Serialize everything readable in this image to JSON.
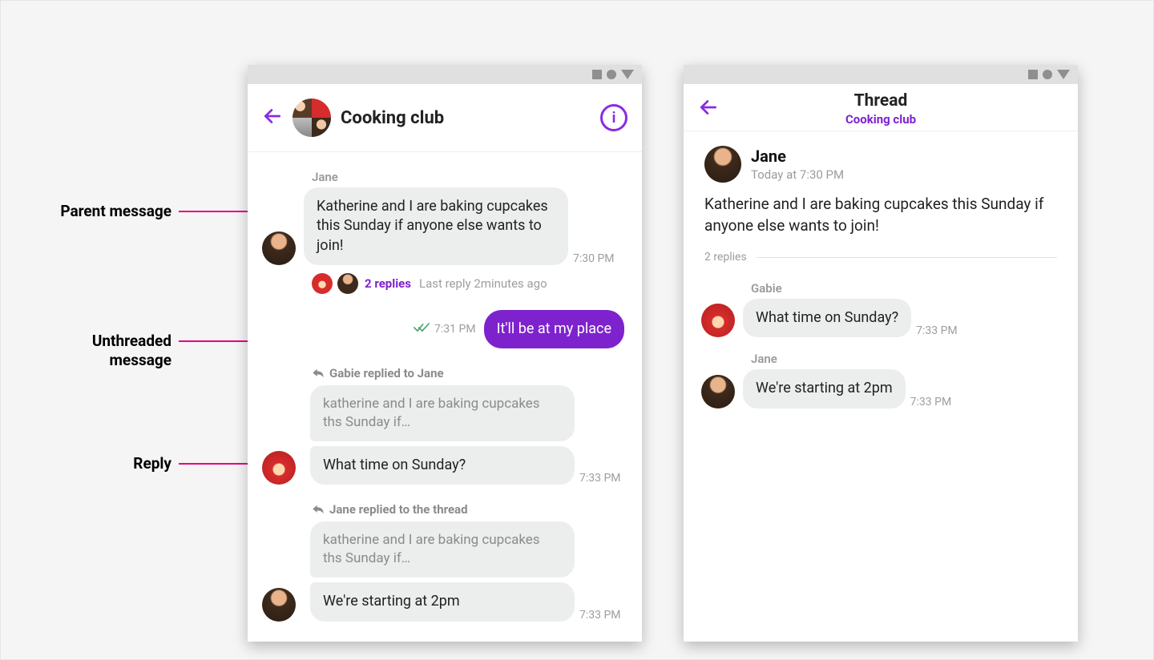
{
  "annotations": {
    "parent": "Parent message",
    "unthreaded_line1": "Unthreaded",
    "unthreaded_line2": "message",
    "reply": "Reply"
  },
  "chat": {
    "title": "Cooking club",
    "message1": {
      "sender": "Jane",
      "body": "Katherine and I are baking cupcakes this Sunday if anyone else wants to join!",
      "time": "7:30 PM",
      "thread": {
        "count_label": "2 replies",
        "last_reply_label": "Last reply 2minutes ago"
      }
    },
    "mine": {
      "body": "It'll be at my place",
      "time": "7:31 PM"
    },
    "reply1": {
      "heading": "Gabie replied to Jane",
      "quoted": "katherine and I are baking cupcakes ths Sunday if…",
      "body": "What time on Sunday?",
      "time": "7:33 PM"
    },
    "reply2": {
      "heading": "Jane replied to the thread",
      "quoted": "katherine and I are baking cupcakes ths Sunday if…",
      "body": "We're starting at 2pm",
      "time": "7:33 PM"
    }
  },
  "thread": {
    "title": "Thread",
    "subtitle": "Cooking club",
    "parent": {
      "sender": "Jane",
      "time": "Today at 7:30 PM",
      "body": "Katherine and I are baking cupcakes this Sunday if anyone else wants to join!"
    },
    "replies_label": "2 replies",
    "replies": [
      {
        "sender": "Gabie",
        "body": "What time on Sunday?",
        "time": "7:33 PM"
      },
      {
        "sender": "Jane",
        "body": "We're starting at 2pm",
        "time": "7:33 PM"
      }
    ]
  }
}
